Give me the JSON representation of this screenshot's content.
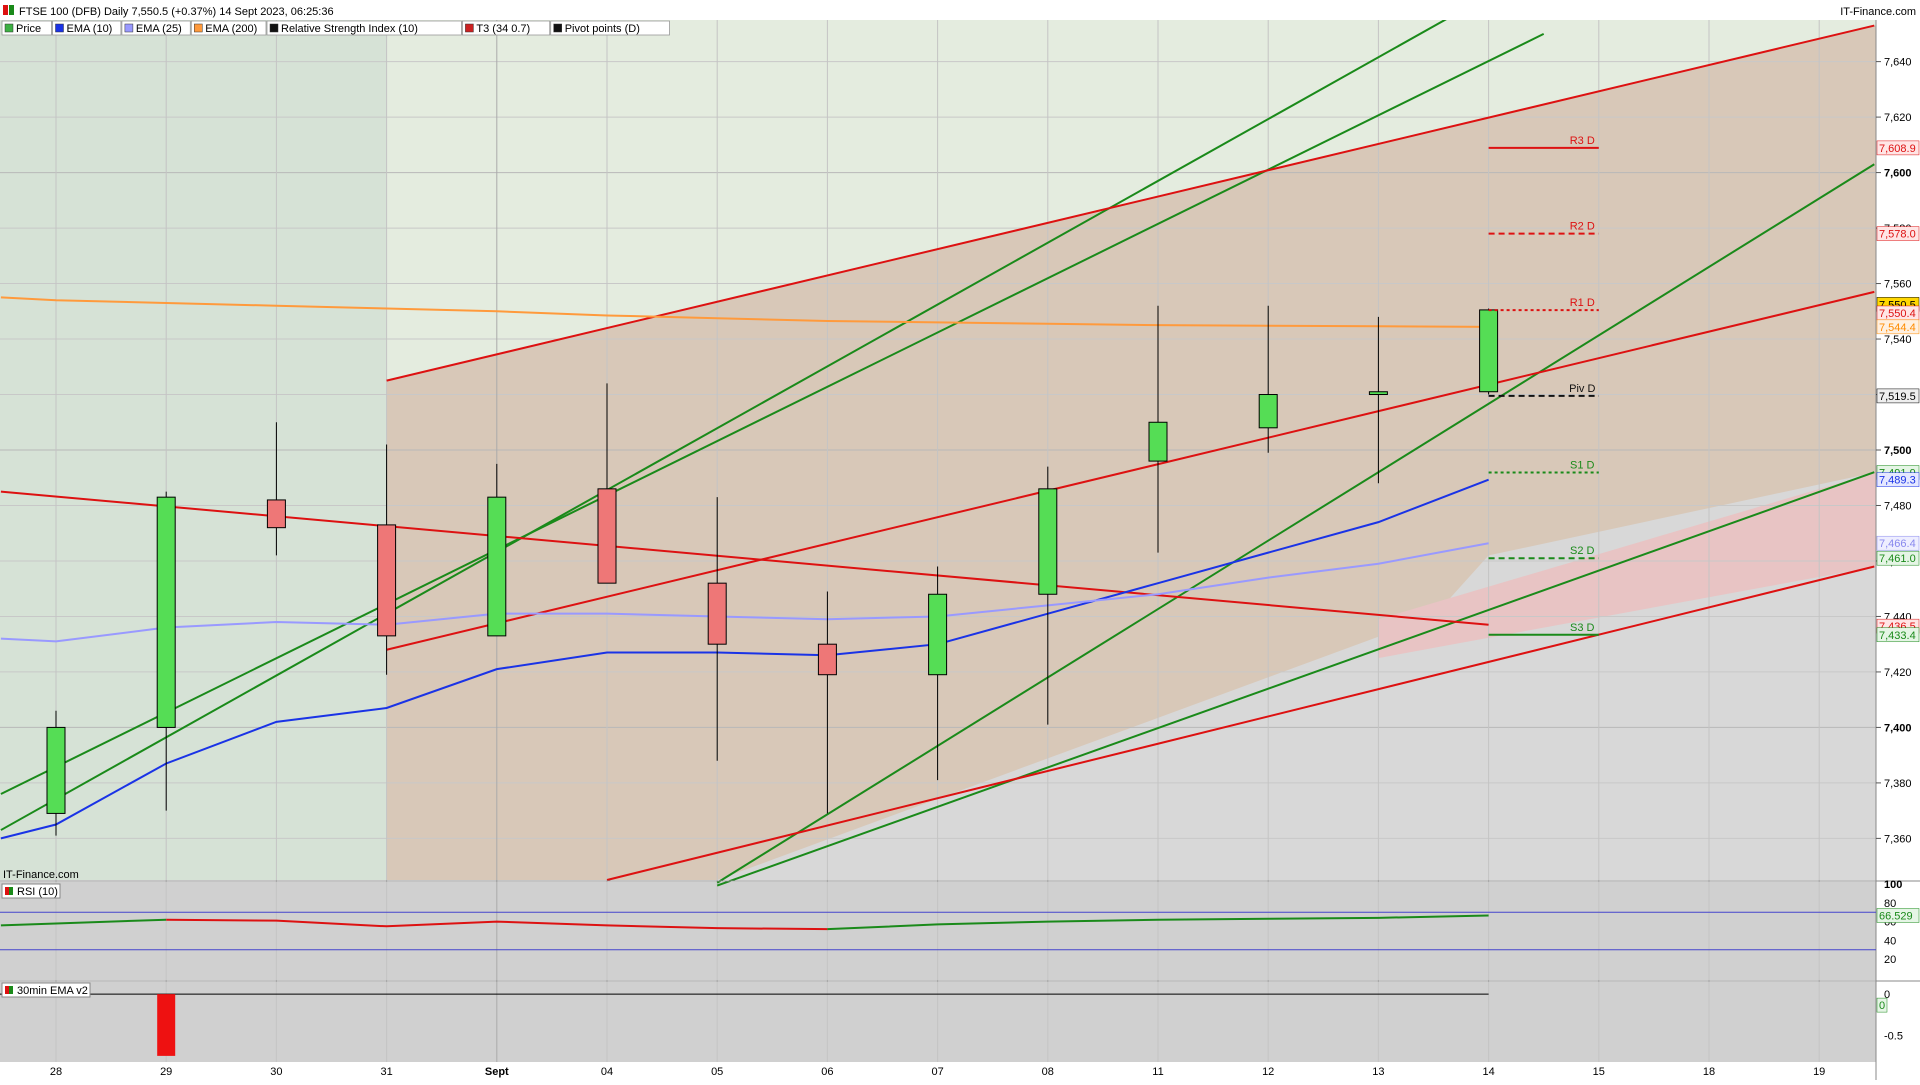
{
  "header": {
    "title": "FTSE 100 (DFB) Daily 7,550.5 (+0.37%) 14 Sept 2023, 06:25:36",
    "brand": "IT-Finance.com",
    "watermark": "IT-Finance.com"
  },
  "legend": [
    {
      "label": "Price",
      "color": "#3cb043",
      "icon": "candle-icon"
    },
    {
      "label": "EMA (10)",
      "color": "#1a33e6",
      "icon": "line-swatch-icon"
    },
    {
      "label": "EMA (25)",
      "color": "#9999ff",
      "icon": "line-swatch-icon"
    },
    {
      "label": "EMA (200)",
      "color": "#ff9a3c",
      "icon": "line-swatch-icon"
    },
    {
      "label": "Relative Strength Index (10)",
      "color": "#111111",
      "icon": "line-swatch-icon"
    },
    {
      "label": "T3 (34 0.7)",
      "color": "#cc2222",
      "icon": "line-swatch-icon"
    },
    {
      "label": "Pivot points (D)",
      "color": "#111111",
      "icon": "line-swatch-icon"
    }
  ],
  "rsi_panel": {
    "title": "RSI (10)",
    "axis_labels": [
      "100",
      "80",
      "60",
      "40",
      "20"
    ],
    "value_label": "66.529"
  },
  "ema30_panel": {
    "title": "30min EMA v2",
    "axis_labels": [
      "0",
      "-0.5"
    ],
    "value_label": "0"
  },
  "chart_data": {
    "type": "candlestick",
    "y_range": [
      7345,
      7655
    ],
    "y_ticks": [
      7360,
      7380,
      7400,
      7420,
      7440,
      7460,
      7480,
      7500,
      7520,
      7540,
      7560,
      7580,
      7600,
      7620,
      7640
    ],
    "y_tick_labels": [
      "7,360",
      "7,380",
      "7,400",
      "7,420",
      "7,440",
      "7,460",
      "7,480",
      "7,500",
      "7,520",
      "7,540",
      "7,560",
      "7,580",
      "7,600",
      "7,620",
      "7,640"
    ],
    "y_bold_ticks": [
      7400,
      7500,
      7600
    ],
    "x_labels": [
      "28",
      "29",
      "30",
      "31",
      "Sept",
      "04",
      "05",
      "06",
      "07",
      "08",
      "11",
      "12",
      "13",
      "14",
      "15",
      "18",
      "19"
    ],
    "x_bold": [
      "Sept"
    ],
    "candles": [
      {
        "open": 7369,
        "close": 7400,
        "high": 7406,
        "low": 7361
      },
      {
        "open": 7400,
        "close": 7483,
        "high": 7485,
        "low": 7370
      },
      {
        "open": 7482,
        "close": 7472,
        "high": 7510,
        "low": 7462
      },
      {
        "open": 7473,
        "close": 7433,
        "high": 7502,
        "low": 7419
      },
      {
        "open": 7433,
        "close": 7483,
        "high": 7495,
        "low": 7433
      },
      {
        "open": 7486,
        "close": 7452,
        "high": 7524,
        "low": 7452
      },
      {
        "open": 7452,
        "close": 7430,
        "high": 7483,
        "low": 7388
      },
      {
        "open": 7430,
        "close": 7419,
        "high": 7449,
        "low": 7369
      },
      {
        "open": 7419,
        "close": 7448,
        "high": 7458,
        "low": 7381
      },
      {
        "open": 7448,
        "close": 7486,
        "high": 7494,
        "low": 7401
      },
      {
        "open": 7496,
        "close": 7510,
        "high": 7552,
        "low": 7463
      },
      {
        "open": 7508,
        "close": 7520,
        "high": 7552,
        "low": 7499
      },
      {
        "open": 7520,
        "close": 7521,
        "high": 7548,
        "low": 7488
      },
      {
        "open": 7521,
        "close": 7550.5,
        "high": 7551,
        "low": 7520
      }
    ],
    "series": [
      {
        "name": "EMA (10)",
        "color": "#1a33e6",
        "values": [
          7360,
          7365,
          7387,
          7402,
          7407,
          7421,
          7427,
          7427,
          7426,
          7430,
          7441,
          7452,
          7463,
          7474,
          7489.3
        ]
      },
      {
        "name": "EMA (25)",
        "color": "#9999ff",
        "values": [
          7432,
          7431,
          7436,
          7438,
          7437,
          7441,
          7441,
          7440,
          7439,
          7440,
          7444,
          7448,
          7454,
          7459,
          7466.4
        ]
      },
      {
        "name": "EMA (200)",
        "color": "#ff9a3c",
        "values": [
          7555,
          7554,
          7553,
          7552,
          7551,
          7550,
          7548.5,
          7547.5,
          7546.5,
          7546,
          7545.5,
          7545,
          7544.8,
          7544.6,
          7544.4
        ]
      }
    ],
    "x_positions": [
      -0.5,
      0,
      1,
      2,
      3,
      4,
      5,
      6,
      7,
      8,
      9,
      10,
      11,
      12,
      13
    ],
    "trend_lines": [
      {
        "color": "#1a8a1a",
        "from": [
          -0.5,
          7363
        ],
        "to": [
          13.5,
          7675
        ]
      },
      {
        "color": "#1a8a1a",
        "from": [
          -0.5,
          7376
        ],
        "to": [
          13.5,
          7650
        ]
      },
      {
        "color": "#1a8a1a",
        "from": [
          6,
          7344
        ],
        "to": [
          16.5,
          7603
        ]
      },
      {
        "color": "#1a8a1a",
        "from": [
          6,
          7343
        ],
        "to": [
          16.5,
          7492
        ]
      },
      {
        "color": "#dd1111",
        "from": [
          3,
          7525
        ],
        "to": [
          16.5,
          7653
        ]
      },
      {
        "color": "#dd1111",
        "from": [
          3,
          7428
        ],
        "to": [
          16.5,
          7557
        ]
      },
      {
        "color": "#dd1111",
        "from": [
          5,
          7345
        ],
        "to": [
          16.5,
          7458
        ]
      },
      {
        "color": "#dd1111",
        "from": [
          -0.5,
          7485
        ],
        "to": [
          13,
          7437
        ]
      }
    ],
    "pivots": [
      {
        "label": "R3 D",
        "value": 7608.9,
        "style": "solid",
        "color": "#dd1111"
      },
      {
        "label": "R2 D",
        "value": 7578.0,
        "style": "dashed",
        "color": "#dd1111"
      },
      {
        "label": "R1 D",
        "value": 7550.4,
        "style": "dotted",
        "color": "#dd1111"
      },
      {
        "label": "Piv D",
        "value": 7519.5,
        "style": "dashed",
        "color": "#111111"
      },
      {
        "label": "S1 D",
        "value": 7491.9,
        "style": "dotted",
        "color": "#1a8a1a"
      },
      {
        "label": "S2 D",
        "value": 7461.0,
        "style": "dashed",
        "color": "#1a8a1a"
      },
      {
        "label": "S3 D",
        "value": 7433.4,
        "style": "solid",
        "color": "#1a8a1a"
      }
    ],
    "price_tags": [
      {
        "text": "7,608.9",
        "value": 7608.9,
        "color": "#dd1111",
        "bg": "#ffe5e5"
      },
      {
        "text": "7,578.0",
        "value": 7578.0,
        "color": "#dd1111",
        "bg": "#ffe5e5"
      },
      {
        "text": "7,550.5",
        "value": 7552.5,
        "color": "#000000",
        "bg": "#ffd700"
      },
      {
        "text": "7,550.4",
        "value": 7549.4,
        "color": "#dd1111",
        "bg": "#ffe5e5"
      },
      {
        "text": "7,544.4",
        "value": 7544.4,
        "color": "#ff8c00",
        "bg": "#fff0e0"
      },
      {
        "text": "7,519.5",
        "value": 7519.5,
        "color": "#000000",
        "bg": "#eeeeee"
      },
      {
        "text": "7,491.9",
        "value": 7491.9,
        "color": "#1a8a1a",
        "bg": "#e5f5e5"
      },
      {
        "text": "7,489.3",
        "value": 7489.3,
        "color": "#1a33e6",
        "bg": "#e5e8ff"
      },
      {
        "text": "7,466.4",
        "value": 7466.4,
        "color": "#8888ee",
        "bg": "#eeeeff"
      },
      {
        "text": "7,461.0",
        "value": 7461.0,
        "color": "#1a8a1a",
        "bg": "#e5f5e5"
      },
      {
        "text": "7,436.5",
        "value": 7436.5,
        "color": "#dd1111",
        "bg": "#ffe5e5"
      },
      {
        "text": "7,433.4",
        "value": 7433.4,
        "color": "#1a8a1a",
        "bg": "#e5f5e5"
      }
    ],
    "rsi": {
      "y_range": [
        0,
        100
      ],
      "levels": [
        70,
        30
      ],
      "segments": [
        {
          "color": "#1a8a1a",
          "x": [
            -0.5,
            0,
            1
          ],
          "y": [
            56,
            58,
            62
          ]
        },
        {
          "color": "#dd1111",
          "x": [
            1,
            2,
            3,
            4,
            5,
            6,
            7
          ],
          "y": [
            62,
            61,
            55,
            60,
            56,
            53,
            52
          ]
        },
        {
          "color": "#1a8a1a",
          "x": [
            7,
            8,
            9,
            10,
            11,
            12,
            13
          ],
          "y": [
            52,
            57,
            60,
            62,
            63,
            64,
            66.5
          ]
        }
      ]
    },
    "ema30": {
      "y_range": [
        -0.8,
        0.05
      ],
      "bars": [
        {
          "x": 1,
          "value": -0.75
        }
      ],
      "zero_line_to": 13
    }
  }
}
